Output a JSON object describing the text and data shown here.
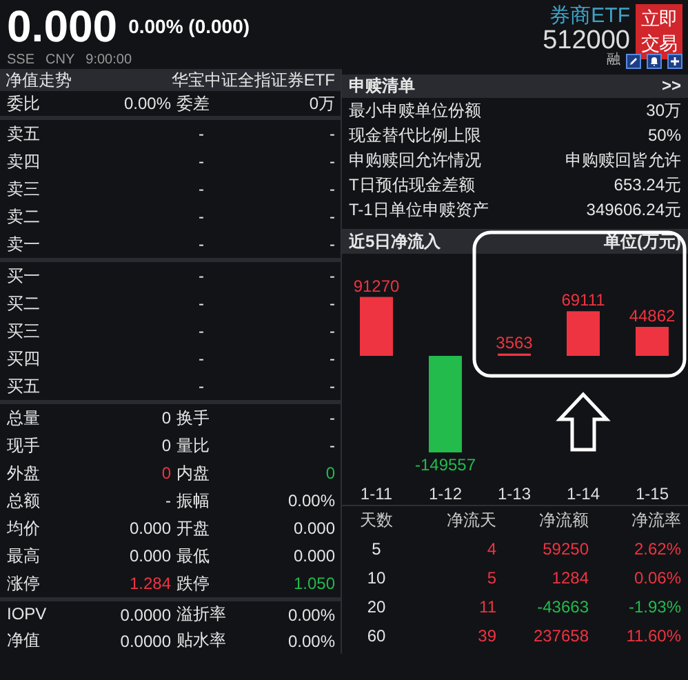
{
  "quote": {
    "price": "0.000",
    "change": "0.00% (0.000)",
    "exchange": "SSE",
    "currency": "CNY",
    "time": "9:00:00",
    "name": "券商ETF",
    "code": "512000",
    "trade_button": "立即交易",
    "margin_tag": "融"
  },
  "left": {
    "title": "净值走势",
    "fund_name": "华宝中证全指证券ETF",
    "ratio": [
      {
        "label": "委比",
        "value": "0.00%"
      },
      {
        "label": "委差",
        "value": "0万"
      }
    ],
    "asks": [
      {
        "label": "卖五",
        "price": "-",
        "volume": "-"
      },
      {
        "label": "卖四",
        "price": "-",
        "volume": "-"
      },
      {
        "label": "卖三",
        "price": "-",
        "volume": "-"
      },
      {
        "label": "卖二",
        "price": "-",
        "volume": "-"
      },
      {
        "label": "卖一",
        "price": "-",
        "volume": "-"
      }
    ],
    "bids": [
      {
        "label": "买一",
        "price": "-",
        "volume": "-"
      },
      {
        "label": "买二",
        "price": "-",
        "volume": "-"
      },
      {
        "label": "买三",
        "price": "-",
        "volume": "-"
      },
      {
        "label": "买四",
        "price": "-",
        "volume": "-"
      },
      {
        "label": "买五",
        "price": "-",
        "volume": "-"
      }
    ],
    "stats": [
      [
        {
          "label": "总量",
          "value": "0"
        },
        {
          "label": "换手",
          "value": "-"
        }
      ],
      [
        {
          "label": "现手",
          "value": "0"
        },
        {
          "label": "量比",
          "value": "-"
        }
      ],
      [
        {
          "label": "外盘",
          "value": "0",
          "color": "#ee3440"
        },
        {
          "label": "内盘",
          "value": "0",
          "color": "#22bb4c"
        }
      ],
      [
        {
          "label": "总额",
          "value": "-"
        },
        {
          "label": "振幅",
          "value": "0.00%"
        }
      ],
      [
        {
          "label": "均价",
          "value": "0.000"
        },
        {
          "label": "开盘",
          "value": "0.000"
        }
      ],
      [
        {
          "label": "最高",
          "value": "0.000"
        },
        {
          "label": "最低",
          "value": "0.000"
        }
      ],
      [
        {
          "label": "涨停",
          "value": "1.284",
          "color": "#ee3440"
        },
        {
          "label": "跌停",
          "value": "1.050",
          "color": "#22bb4c"
        }
      ]
    ],
    "nav": [
      [
        {
          "label": "IOPV",
          "value": "0.0000"
        },
        {
          "label": "溢折率",
          "value": "0.00%"
        }
      ],
      [
        {
          "label": "净值",
          "value": "0.0000"
        },
        {
          "label": "贴水率",
          "value": "0.00%"
        }
      ]
    ]
  },
  "creation": {
    "title": "申赎清单",
    "more": ">>",
    "rows": [
      {
        "label": "最小申赎单位份额",
        "value": "30万"
      },
      {
        "label": "现金替代比例上限",
        "value": "50%"
      },
      {
        "label": "申购赎回允许情况",
        "value": "申购赎回皆允许"
      },
      {
        "label": "T日预估现金差额",
        "value": "653.24元"
      },
      {
        "label": "T-1日单位申赎资产",
        "value": "349606.24元"
      }
    ]
  },
  "net_inflow": {
    "title": "近5日净流入",
    "unit": "单位(万元)",
    "chart_data": {
      "type": "bar",
      "categories": [
        "1-11",
        "1-12",
        "1-13",
        "1-14",
        "1-15"
      ],
      "values": [
        91270,
        -149557,
        3563,
        69111,
        44862
      ],
      "data_labels": true
    },
    "highlight_frame": true,
    "pointer_arrow": true
  },
  "flow_table": {
    "columns": [
      "天数",
      "净流天",
      "净流额",
      "净流率"
    ],
    "rows": [
      [
        {
          "text": "5"
        },
        {
          "text": "4",
          "color": "#ee3440"
        },
        {
          "text": "59250",
          "color": "#ee3440"
        },
        {
          "text": "2.62%",
          "color": "#ee3440"
        }
      ],
      [
        {
          "text": "10"
        },
        {
          "text": "5",
          "color": "#ee3440"
        },
        {
          "text": "1284",
          "color": "#ee3440"
        },
        {
          "text": "0.06%",
          "color": "#ee3440"
        }
      ],
      [
        {
          "text": "20"
        },
        {
          "text": "11",
          "color": "#ee3440"
        },
        {
          "text": "-43663",
          "color": "#22bb4c"
        },
        {
          "text": "-1.93%",
          "color": "#22bb4c"
        }
      ],
      [
        {
          "text": "60"
        },
        {
          "text": "39",
          "color": "#ee3440"
        },
        {
          "text": "237658",
          "color": "#ee3440"
        },
        {
          "text": "11.60%",
          "color": "#ee3440"
        }
      ]
    ]
  }
}
